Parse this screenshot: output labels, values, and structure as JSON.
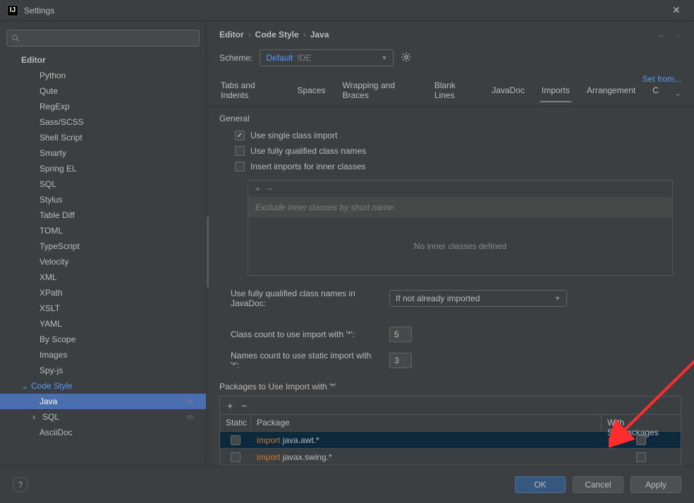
{
  "window": {
    "title": "Settings"
  },
  "search": {
    "placeholder": ""
  },
  "sidebar": {
    "header": "Editor",
    "items": [
      "Python",
      "Qute",
      "RegExp",
      "Sass/SCSS",
      "Shell Script",
      "Smarty",
      "Spring EL",
      "SQL",
      "Stylus",
      "Table Diff",
      "TOML",
      "TypeScript",
      "Velocity",
      "XML",
      "XPath",
      "XSLT",
      "YAML",
      "By Scope",
      "Images",
      "Spy-js"
    ],
    "code_style": "Code Style",
    "code_style_children": {
      "java": "Java",
      "sql": "SQL",
      "asciidoc": "AsciiDoc"
    }
  },
  "breadcrumbs": [
    "Editor",
    "Code Style",
    "Java"
  ],
  "scheme": {
    "label": "Scheme:",
    "value": "Default",
    "ide": "IDE"
  },
  "set_from": "Set from...",
  "tabs": [
    "Tabs and Indents",
    "Spaces",
    "Wrapping and Braces",
    "Blank Lines",
    "JavaDoc",
    "Imports",
    "Arrangement",
    "C"
  ],
  "active_tab": "Imports",
  "general": {
    "header": "General",
    "chk1": "Use single class import",
    "chk2": "Use fully qualified class names",
    "chk3": "Insert imports for inner classes",
    "inner_placeholder": "Exclude inner classes by short name:",
    "inner_empty": "No inner classes defined",
    "fq_label": "Use fully qualified class names in JavaDoc:",
    "fq_value": "If not already imported",
    "class_count_label": "Class count to use import with '*':",
    "class_count_value": "5",
    "names_count_label": "Names count to use static import with '*':",
    "names_count_value": "3"
  },
  "packages": {
    "header": "Packages to Use Import with '*'",
    "col_static": "Static",
    "col_package": "Package",
    "col_sub": "With Subpackages",
    "rows": [
      {
        "kw": "import",
        "rest": " java.awt.*",
        "selected": true
      },
      {
        "kw": "import",
        "rest": " javax.swing.*",
        "selected": false
      }
    ]
  },
  "footer": {
    "ok": "OK",
    "cancel": "Cancel",
    "apply": "Apply"
  }
}
